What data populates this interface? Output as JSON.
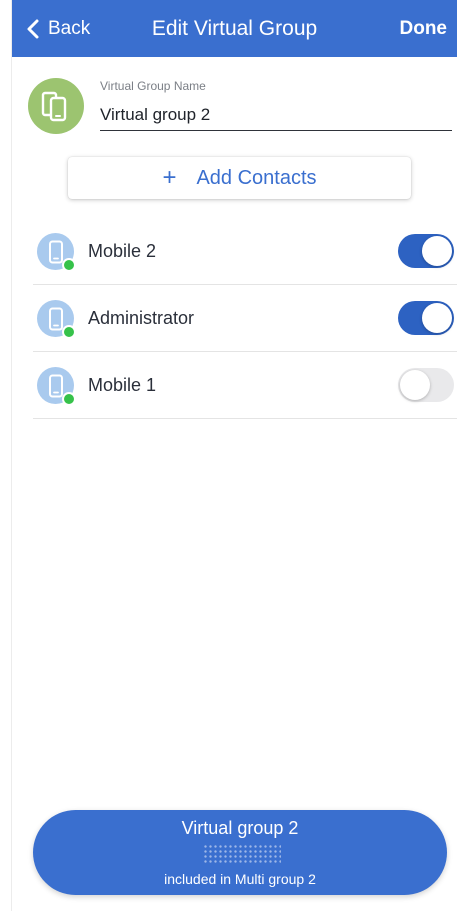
{
  "nav": {
    "back_label": "Back",
    "title": "Edit Virtual Group",
    "done_label": "Done"
  },
  "group": {
    "name_label": "Virtual Group Name",
    "name_value": "Virtual group 2",
    "avatar_icon": "devices-icon"
  },
  "add_contacts": {
    "label": "Add Contacts",
    "icon": "plus-icon"
  },
  "contacts": [
    {
      "name": "Mobile 2",
      "enabled": true,
      "status": "online",
      "icon": "mobile-phone-icon"
    },
    {
      "name": "Administrator",
      "enabled": true,
      "status": "online",
      "icon": "mobile-phone-icon"
    },
    {
      "name": "Mobile 1",
      "enabled": false,
      "status": "online",
      "icon": "mobile-phone-icon"
    }
  ],
  "bottom_bar": {
    "title": "Virtual group 2",
    "subtitle": "included in Multi group 2"
  },
  "colors": {
    "accent": "#3a6fcf",
    "toggle_on": "#2d62c2",
    "toggle_off": "#e9e9eb",
    "group_avatar": "#9cc470",
    "contact_avatar": "#a9caee",
    "presence_online": "#36c24a"
  }
}
